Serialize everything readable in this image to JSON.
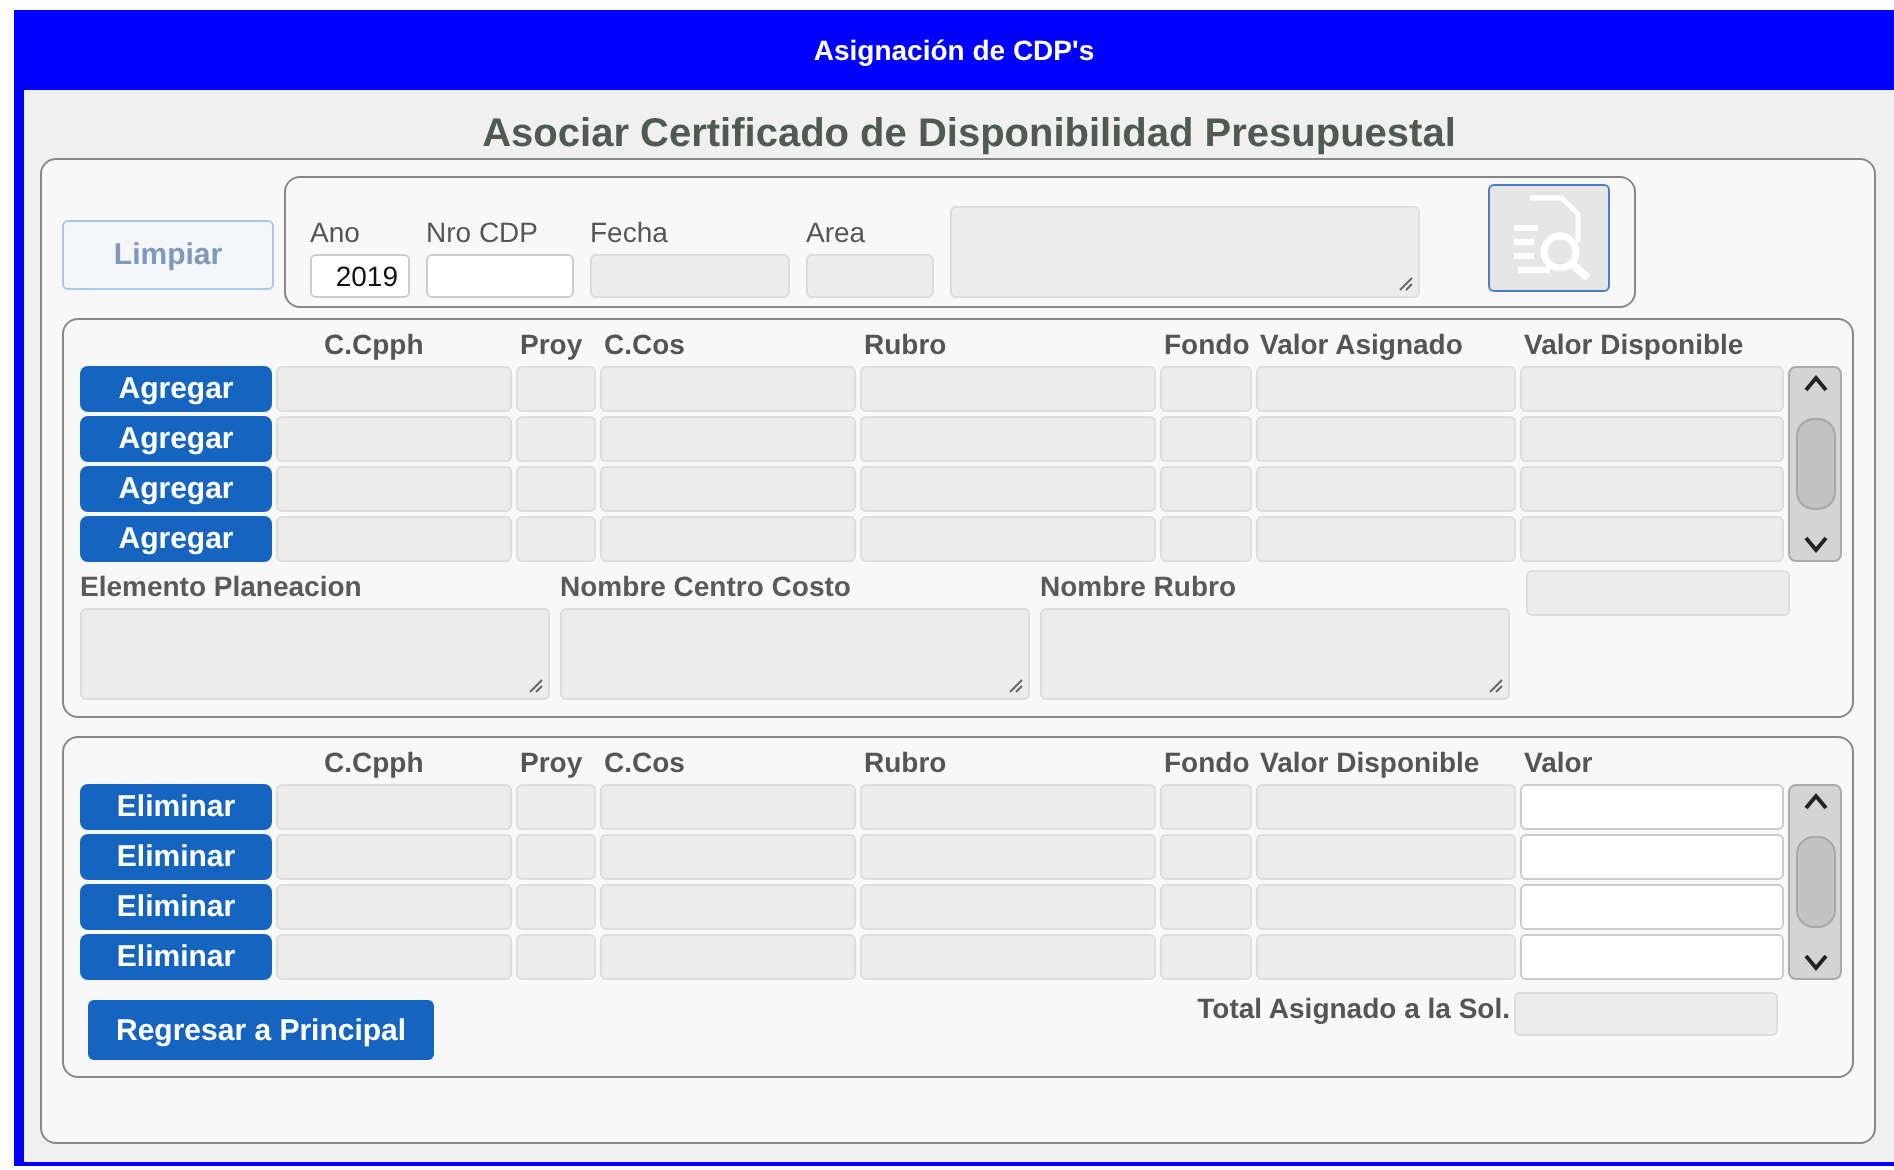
{
  "window": {
    "title": "Asignación de CDP's"
  },
  "heading": "Asociar Certificado de Disponibilidad Presupuestal",
  "header": {
    "clear_button": {
      "label": "Limpiar",
      "disabled": true
    },
    "fields": [
      {
        "label": "Ano",
        "value": "2019",
        "kind": "input"
      },
      {
        "label": "Nro CDP",
        "kind": "input"
      },
      {
        "label": "Fecha",
        "kind": "readonly"
      },
      {
        "label": "Area",
        "kind": "readonly"
      },
      {
        "kind": "textarea"
      }
    ]
  },
  "assigned": {
    "columns": [
      {
        "label": "C.Cpph",
        "editable": false
      },
      {
        "label": "Proy",
        "editable": false
      },
      {
        "label": "C.Cos",
        "editable": false
      },
      {
        "label": "Rubro",
        "editable": false
      },
      {
        "label": "Fondo",
        "editable": false
      },
      {
        "label": "Valor Asignado",
        "editable": false
      },
      {
        "label": "Valor Disponible",
        "editable": false
      }
    ],
    "rows": [
      {
        "action": "Agregar"
      },
      {
        "action": "Agregar"
      },
      {
        "action": "Agregar"
      },
      {
        "action": "Agregar"
      }
    ],
    "details": [
      {
        "label": "Elemento Planeacion"
      },
      {
        "label": "Nombre Centro Costo"
      },
      {
        "label": "Nombre Rubro"
      }
    ]
  },
  "selected": {
    "columns": [
      {
        "label": "C.Cpph",
        "editable": false
      },
      {
        "label": "Proy",
        "editable": false
      },
      {
        "label": "C.Cos",
        "editable": false
      },
      {
        "label": "Rubro",
        "editable": false
      },
      {
        "label": "Fondo",
        "editable": false
      },
      {
        "label": "Valor Disponible",
        "editable": false
      },
      {
        "label": "Valor",
        "editable": true
      }
    ],
    "rows": [
      {
        "action": "Eliminar"
      },
      {
        "action": "Eliminar"
      },
      {
        "action": "Eliminar"
      },
      {
        "action": "Eliminar"
      }
    ],
    "back_button": "Regresar a Principal",
    "total_label": "Total Asignado a la Sol."
  }
}
